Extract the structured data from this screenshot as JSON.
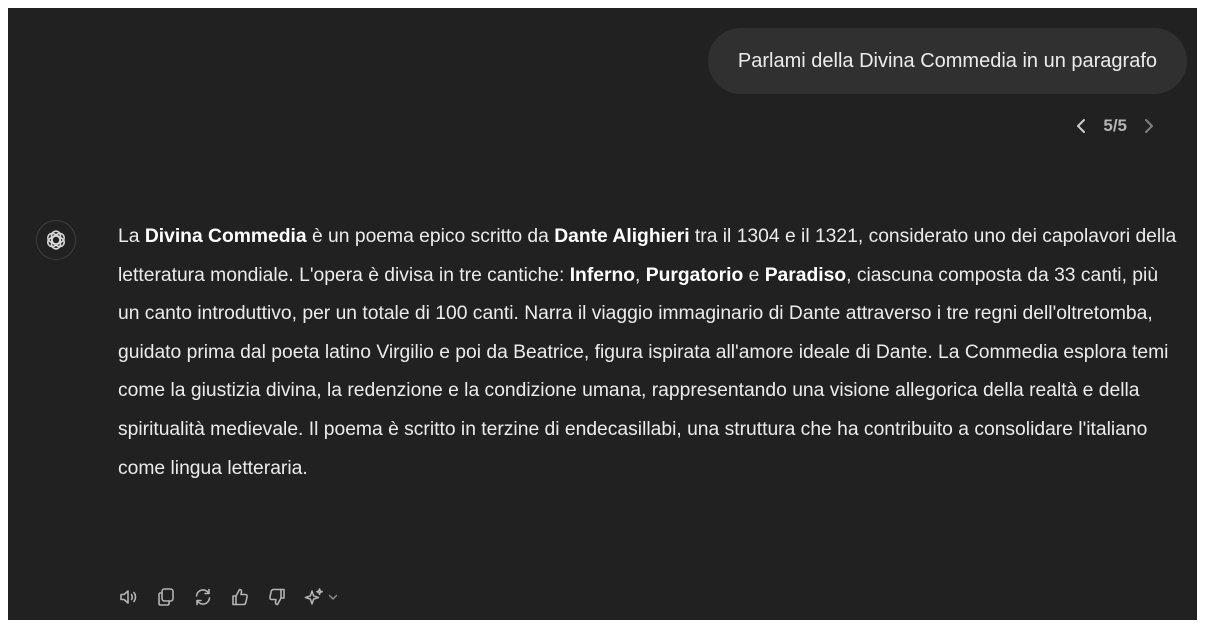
{
  "user_message": {
    "text": "Parlami della Divina Commedia in un paragrafo"
  },
  "pager": {
    "label": "5/5"
  },
  "assistant_message": {
    "segments": [
      {
        "text": "La ",
        "bold": false
      },
      {
        "text": "Divina Commedia",
        "bold": true
      },
      {
        "text": " è un poema epico scritto da ",
        "bold": false
      },
      {
        "text": "Dante Alighieri",
        "bold": true
      },
      {
        "text": " tra il 1304 e il 1321, considerato uno dei capolavori della letteratura mondiale. L'opera è divisa in tre cantiche: ",
        "bold": false
      },
      {
        "text": "Inferno",
        "bold": true
      },
      {
        "text": ", ",
        "bold": false
      },
      {
        "text": "Purgatorio",
        "bold": true
      },
      {
        "text": " e ",
        "bold": false
      },
      {
        "text": "Paradiso",
        "bold": true
      },
      {
        "text": ", ciascuna composta da 33 canti, più un canto introduttivo, per un totale di 100 canti. Narra il viaggio immaginario di Dante attraverso i tre regni dell'oltretomba, guidato prima dal poeta latino Virgilio e poi da Beatrice, figura ispirata all'amore ideale di Dante. La Commedia esplora temi come la giustizia divina, la redenzione e la condizione umana, rappresentando una visione allegorica della realtà e della spiritualità medievale. Il poema è scritto in terzine di endecasillabi, una struttura che ha contribuito a consolidare l'italiano come lingua letteraria.",
        "bold": false
      }
    ]
  },
  "icons": {
    "avatar": "openai-logo-icon",
    "pager_prev": "chevron-left-icon",
    "pager_next": "chevron-right-icon",
    "actions": [
      "speaker-icon",
      "copy-icon",
      "regenerate-icon",
      "thumbs-up-icon",
      "thumbs-down-icon",
      "sparkle-icon",
      "chevron-down-icon"
    ]
  },
  "colors": {
    "background": "#212121",
    "user_bubble": "#303030",
    "text": "#ececec",
    "muted": "#b4b4b4"
  }
}
